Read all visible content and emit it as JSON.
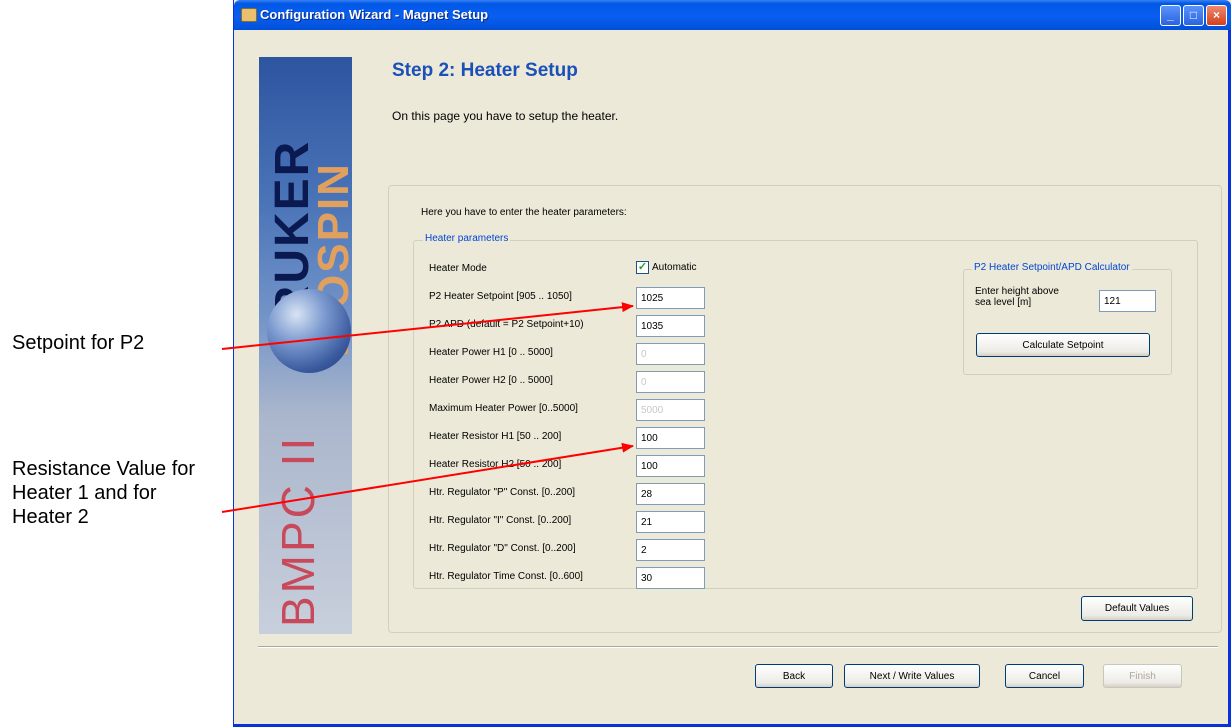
{
  "annotations": {
    "setpoint": "Setpoint for P2",
    "resistance": "Resistance Value for Heater 1 and for Heater 2"
  },
  "window": {
    "title": "Configuration Wizard - Magnet Setup",
    "minimize": "_",
    "maximize": "□",
    "close": "×"
  },
  "logo": {
    "brand": "BRUKER",
    "sub": "BIOSPIN",
    "product": "BMPC II"
  },
  "step": {
    "title": "Step 2: Heater Setup",
    "description": "On this page you have to setup the heater."
  },
  "intro": "Here you have to enter the heater parameters:",
  "group_label": "Heater parameters",
  "heater_mode": {
    "label": "Heater Mode",
    "checkbox_label": "Automatic",
    "checked": true
  },
  "params": [
    {
      "label": "P2 Heater Setpoint [905 .. 1050]",
      "value": "1025",
      "enabled": true
    },
    {
      "label": "P2 APD (default = P2 Setpoint+10)",
      "value": "1035",
      "enabled": true
    },
    {
      "label": "Heater Power H1 [0 .. 5000]",
      "value": "0",
      "enabled": false
    },
    {
      "label": "Heater Power H2 [0 .. 5000]",
      "value": "0",
      "enabled": false
    },
    {
      "label": "Maximum Heater Power [0..5000]",
      "value": "5000",
      "enabled": false
    },
    {
      "label": "Heater Resistor H1 [50 .. 200]",
      "value": "100",
      "enabled": true
    },
    {
      "label": "Heater Resistor H2 [50 .. 200]",
      "value": "100",
      "enabled": true
    },
    {
      "label": "Htr. Regulator \"P\" Const. [0..200]",
      "value": "28",
      "enabled": true
    },
    {
      "label": "Htr. Regulator \"I\" Const. [0..200]",
      "value": "21",
      "enabled": true
    },
    {
      "label": "Htr. Regulator \"D\" Const. [0..200]",
      "value": "2",
      "enabled": true
    },
    {
      "label": "Htr. Regulator Time Const. [0..600]",
      "value": "30",
      "enabled": true
    }
  ],
  "calculator": {
    "title": "P2 Heater Setpoint/APD Calculator",
    "height_label": "Enter height above sea level [m]",
    "height_value": "121",
    "calculate_button": "Calculate Setpoint"
  },
  "buttons": {
    "default_values": "Default Values",
    "back": "Back",
    "next": "Next / Write Values",
    "cancel": "Cancel",
    "finish": "Finish"
  },
  "colors": {
    "window_bg": "#ece9d8",
    "title_blue": "#0058e6",
    "step_title": "#1a50b8",
    "arrow": "#ff0000"
  }
}
